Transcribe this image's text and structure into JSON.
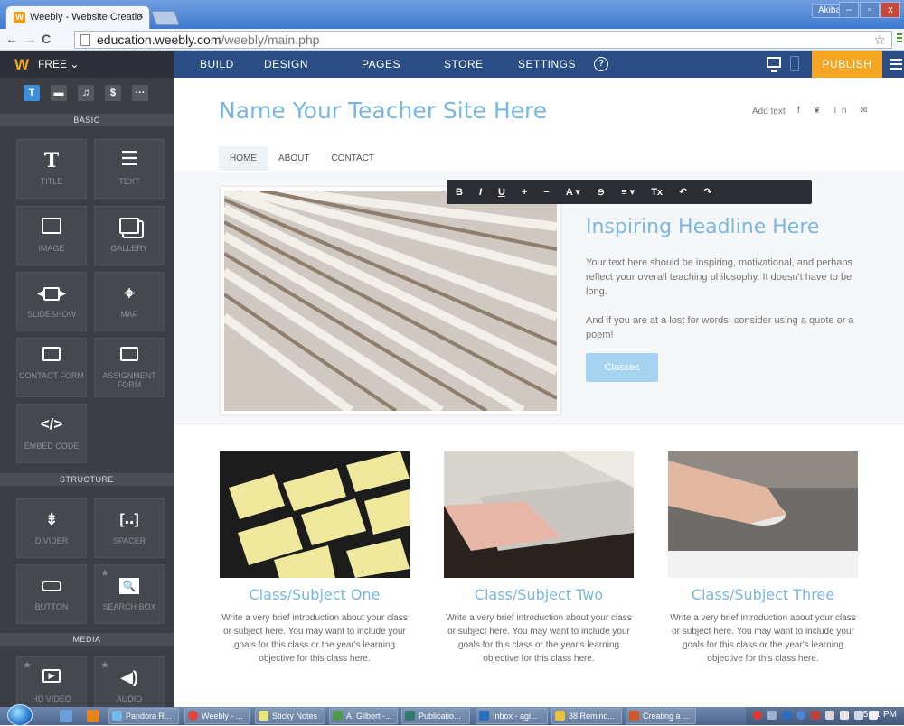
{
  "browser": {
    "tab_title": "Weebly - Website Creatio",
    "tab_close": "×",
    "user": "Akiba",
    "url_host": "education.weebly.com",
    "url_path": "/weebly/main.php",
    "min_btn": "‒",
    "max_btn": "▫",
    "close_btn": "x"
  },
  "weebly_bar": {
    "plan": "FREE ⌄",
    "nav": [
      "BUILD",
      "DESIGN",
      "PAGES",
      "STORE",
      "SETTINGS"
    ],
    "help": "?",
    "publish": "PUBLISH"
  },
  "panel": {
    "category_tabs": [
      "T",
      "▬",
      "♫",
      "$",
      "···"
    ],
    "sections": {
      "basic": "BASIC",
      "structure": "STRUCTURE",
      "media": "MEDIA"
    },
    "elements": {
      "title": "TITLE",
      "text": "TEXT",
      "image": "IMAGE",
      "gallery": "GALLERY",
      "slideshow": "SLIDESHOW",
      "map": "MAP",
      "contact_form": "CONTACT FORM",
      "assignment_form": "ASSIGNMENT FORM",
      "embed_code": "EMBED CODE",
      "divider": "DIVIDER",
      "spacer": "SPACER",
      "button": "BUTTON",
      "search_box": "SEARCH BOX",
      "hd_video": "HD VIDEO",
      "audio": "AUDIO"
    }
  },
  "site": {
    "title": "Name Your Teacher Site Here",
    "add_text": "Add text",
    "social": "f  ❦  in  ✉",
    "nav": [
      "HOME",
      "ABOUT",
      "CONTACT"
    ],
    "hero": {
      "headline": "Inspiring Headline Here",
      "para1": "Your text here should be inspiring, motivational, and perhaps reflect your overall teaching philosophy. It doesn't have to be long.",
      "para2": "And if you are at a lost for words, consider using a quote or a poem!",
      "button": "Classes"
    },
    "format_toolbar": [
      "B",
      "I",
      "U",
      "+",
      "−",
      "A ▾",
      "⊖",
      "≡ ▾",
      "Tx",
      "↶",
      "↷"
    ],
    "columns": [
      {
        "title": "Class/Subject One",
        "text": "Write a very brief introduction about your class or subject here. You may want to include your goals for this class or the year's learning objective for this class here."
      },
      {
        "title": "Class/Subject Two",
        "text": "Write a very brief introduction about your class or subject here. You may want to include your goals for this class or the year's learning objective for this class here."
      },
      {
        "title": "Class/Subject Three",
        "text": "Write a very brief introduction about your class or subject here. You may want to include your goals for this class or the year's learning objective for this class here."
      }
    ]
  },
  "taskbar": {
    "items": [
      "Pandora R...",
      "Weebly - ...",
      "Sticky Notes",
      "A. Gilbert -...",
      "Publicatio...",
      "Inbox - agi...",
      "38 Remind...",
      "Creating a ..."
    ],
    "clock": "5:41 PM"
  },
  "colors": {
    "accent": "#7ab8df",
    "publish": "#f5a623",
    "weebly_bar": "#2a4d86"
  }
}
